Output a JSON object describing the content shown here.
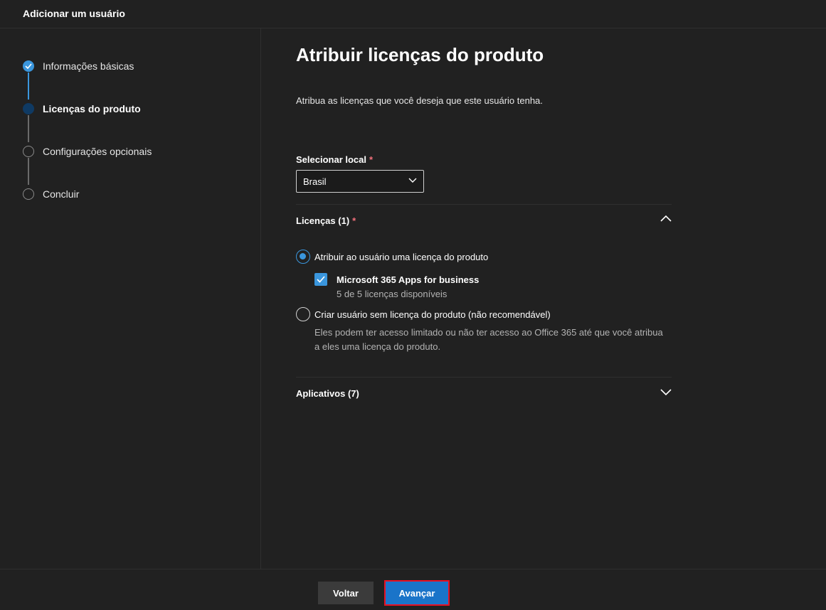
{
  "header": {
    "title": "Adicionar um usuário"
  },
  "steps": [
    {
      "label": "Informações básicas",
      "state": "done"
    },
    {
      "label": "Licenças do produto",
      "state": "current"
    },
    {
      "label": "Configurações opcionais",
      "state": "future"
    },
    {
      "label": "Concluir",
      "state": "future"
    }
  ],
  "main": {
    "title": "Atribuir licenças do produto",
    "description": "Atribua as licenças que você deseja que este usuário tenha.",
    "location": {
      "label": "Selecionar local",
      "required_mark": "*",
      "value": "Brasil"
    },
    "licenses": {
      "title": "Licenças (1)",
      "required_mark": "*",
      "expanded": true,
      "option_assign": "Atribuir ao usuário uma licença do produto",
      "product": {
        "name": "Microsoft 365 Apps for business",
        "availability": "5 de 5 licenças disponíveis",
        "checked": true
      },
      "option_none": "Criar usuário sem licença do produto (não recomendável)",
      "option_none_desc": "Eles podem ter acesso limitado ou não ter acesso ao Office 365 até que você atribua a eles uma licença do produto."
    },
    "apps": {
      "title": "Aplicativos (7)",
      "expanded": false
    }
  },
  "footer": {
    "back_label": "Voltar",
    "next_label": "Avançar"
  },
  "colors": {
    "accent": "#3a96dd",
    "primary_button": "#1a74c9",
    "highlight_border": "#e81123",
    "required": "#f1707b"
  }
}
